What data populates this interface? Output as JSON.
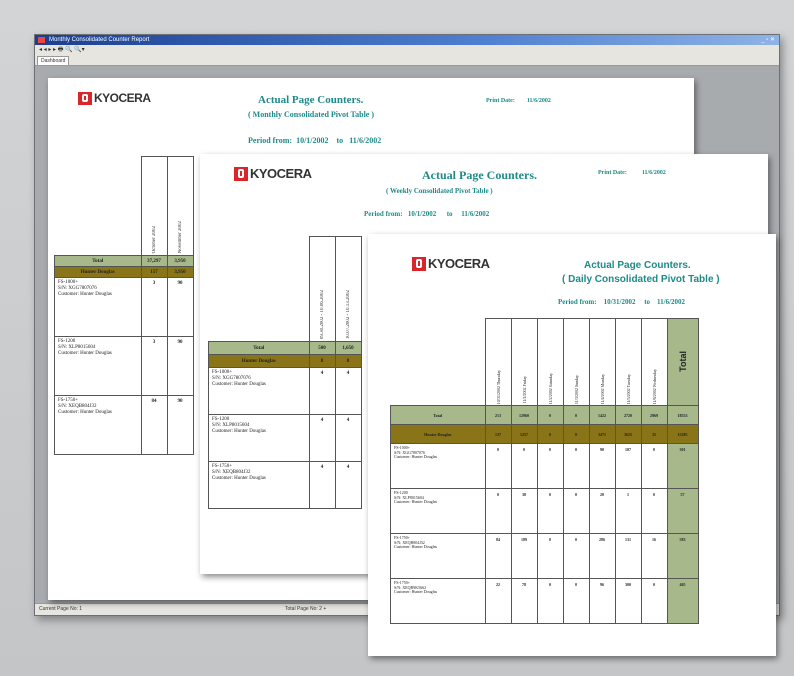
{
  "window": {
    "title": "Monthly Consolidated Counter Report",
    "toolbar": "◂ ◂ ▸ ▸ 🖶 🔍 🔍▾",
    "tab_label": "Dashboard",
    "status_left": "Current Page No: 1",
    "status_mid": "Total Page No: 2 +",
    "win_buttons": "_ ▫ ✕"
  },
  "logo_text": "KYOCERA",
  "page1": {
    "title": "Actual Page Counters.",
    "subtitle": "( Monthly Consolidated Pivot Table )",
    "print_date_label": "Print Date:",
    "print_date_value": "11/6/2002",
    "period_label": "Period from:",
    "period_from": "10/1/2002",
    "period_to_label": "to",
    "period_to": "11/6/2002",
    "columns": [
      "October 2002",
      "November 2002"
    ],
    "total_label": "Total",
    "total_values": [
      "37,297",
      "3,950"
    ],
    "dealer_label": "Hunter Douglas",
    "dealer_values": [
      "157",
      "3,950"
    ],
    "rows": [
      {
        "name": "FS-1000+\nS/N: XGG7807076\nCustomer: Hunter Douglas",
        "values": [
          "3",
          "90"
        ]
      },
      {
        "name": "FS-1200\nS/N: XLP8015604\nCustomer: Hunter Douglas",
        "values": [
          "3",
          "90"
        ]
      },
      {
        "name": "FS-1750+\nS/N: XEQB804J32\nCustomer: Hunter Douglas",
        "values": [
          "84",
          "90"
        ]
      }
    ]
  },
  "page2": {
    "title": "Actual Page Counters.",
    "subtitle": "( Weekly Consolidated Pivot Table )",
    "print_date_label": "Print Date:",
    "print_date_value": "11/6/2002",
    "period_label": "Period from:",
    "period_from": "10/1/2002",
    "period_to_label": "to",
    "period_to": "11/6/2002",
    "columns": [
      "09.30.2002 - 10.06.2002",
      "10.07.2002 - 10.13.2002"
    ],
    "total_label": "Total",
    "total_values": [
      "500",
      "1,650"
    ],
    "dealer_label": "Hunter Douglas",
    "dealer_values": [
      "8",
      "8"
    ],
    "rows": [
      {
        "name": "FS-1000+\nS/N: XGG7807076\nCustomer: Hunter Douglas",
        "values": [
          "4",
          "4"
        ]
      },
      {
        "name": "FS-1200\nS/N: XLP8015604\nCustomer: Hunter Douglas",
        "values": [
          "4",
          "4"
        ]
      },
      {
        "name": "FS-1750+\nS/N: XEQB804J32\nCustomer: Hunter Douglas",
        "values": [
          "4",
          "4"
        ]
      }
    ]
  },
  "page3": {
    "title": "Actual Page Counters.",
    "subtitle": "( Daily Consolidated Pivot Table )",
    "period_label": "Period from:",
    "period_from": "10/31/2002",
    "period_to_label": "to",
    "period_to": "11/6/2002",
    "columns": [
      "10/31/2002 Thursday",
      "11/1/2002 Friday",
      "11/2/2002 Saturday",
      "11/3/2002 Sunday",
      "11/4/2002 Monday",
      "11/5/2002 Tuesday",
      "11/6/2002 Wednesday"
    ],
    "total_header": "Total",
    "total_label": "Total",
    "total_values": [
      "213",
      "12960",
      "0",
      "0",
      "1422",
      "2720",
      "2969",
      "18553"
    ],
    "dealer_label": "Hunter Douglas",
    "dealer_values": [
      "137",
      "1257",
      "0",
      "0",
      "3471",
      "3625",
      "35",
      "15285"
    ],
    "rows": [
      {
        "name": "FS-1000+\nS/N: XGG7807076\nCustomer: Hunter Douglas",
        "values": [
          "0",
          "0",
          "0",
          "0",
          "90",
          "107",
          "0",
          "301"
        ]
      },
      {
        "name": "FS-1200\nS/N: XLP8015604\nCustomer: Hunter Douglas",
        "values": [
          "0",
          "38",
          "0",
          "0",
          "20",
          "1",
          "0",
          "57"
        ]
      },
      {
        "name": "FS-1750+\nS/N: XEQB804J32\nCustomer: Hunter Douglas",
        "values": [
          "84",
          "189",
          "0",
          "0",
          "286",
          "131",
          "16",
          "583"
        ]
      },
      {
        "name": "FS-1750+\nS/N: XEQB9K5662\nCustomer: Hunter Douglas",
        "values": [
          "22",
          "78",
          "0",
          "0",
          "96",
          "300",
          "0",
          "465"
        ]
      }
    ]
  }
}
